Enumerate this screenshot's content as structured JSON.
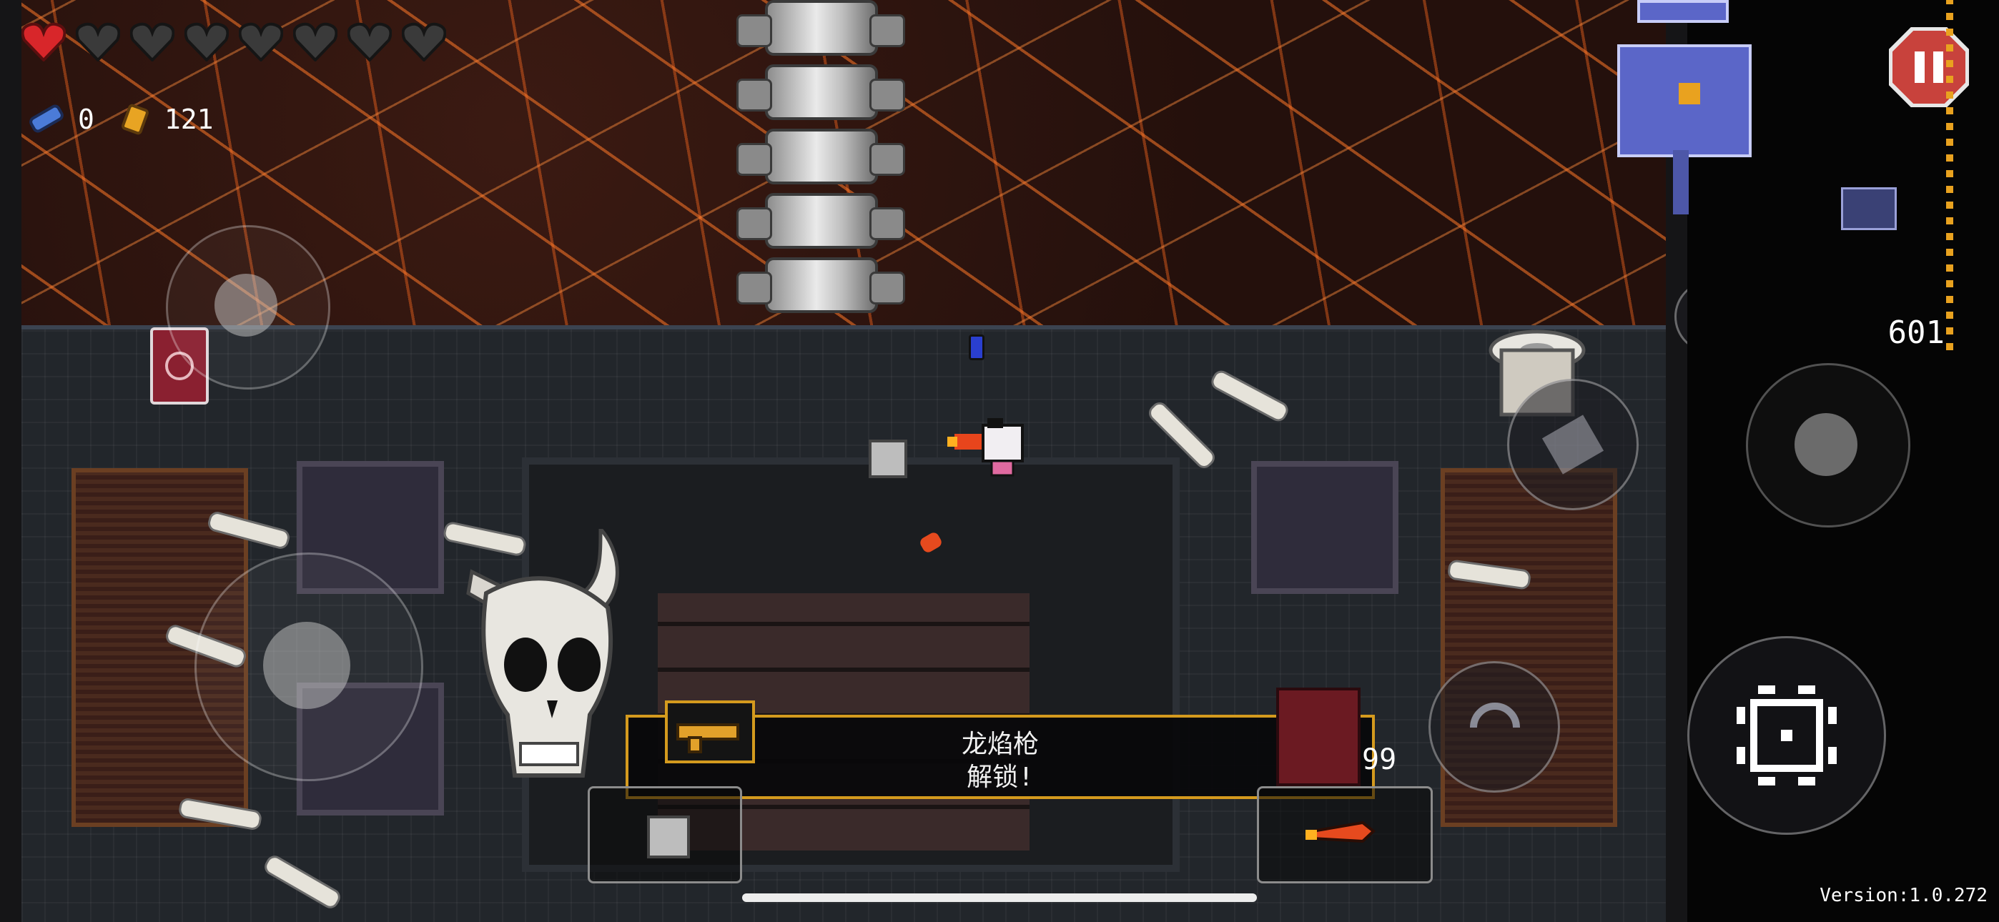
{
  "hud": {
    "hearts": {
      "full": 1,
      "empty": 7,
      "total": 8
    },
    "blanks_count": "0",
    "shells_count": "121"
  },
  "unlock_popup": {
    "item_name": "龙焰枪",
    "message": "解锁!"
  },
  "ammo_count": "99",
  "score": "601",
  "version": "Version:1.0.272",
  "icons": {
    "pause": "pause-icon",
    "minimap": "minimap",
    "crosshair": "crosshair-icon",
    "reload": "reload-icon",
    "dodge": "dodge-roll-icon",
    "active_item": "active-item-icon",
    "gun": "dragon-flame-gun-icon",
    "blank": "blank-icon",
    "shell": "shell-currency-icon"
  },
  "colors": {
    "accent_gold": "#d49a1e",
    "pause_red": "#c8423c",
    "heart_red": "#d8262a",
    "lava_orange": "#ff7a2a"
  }
}
